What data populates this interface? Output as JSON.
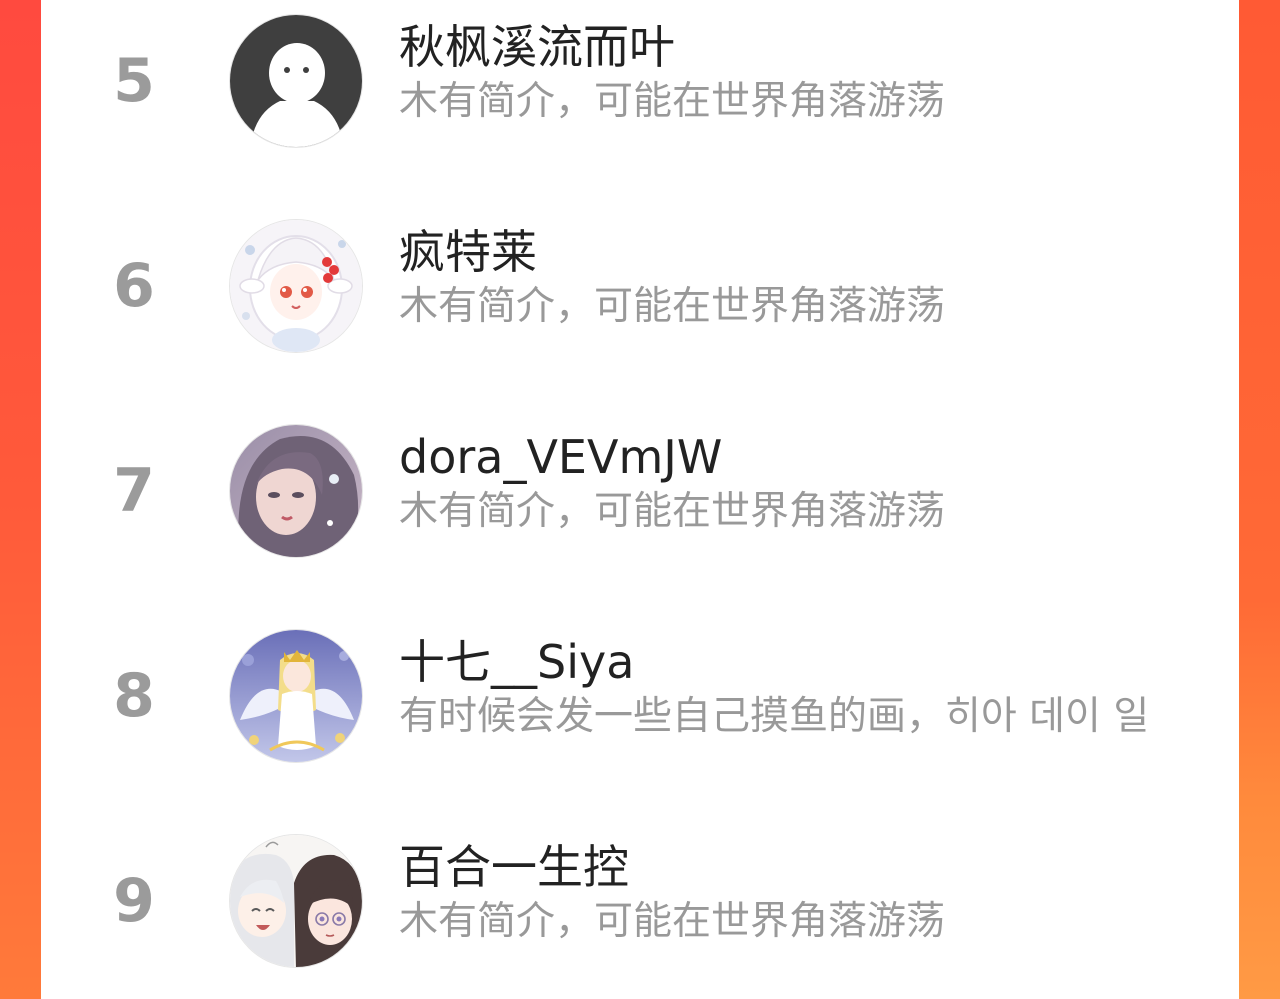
{
  "ranking": {
    "items": [
      {
        "rank": "5",
        "name": "秋枫溪流而叶",
        "bio": "木有简介，可能在世界角落游荡",
        "avatar_icon": "default-ghost-avatar"
      },
      {
        "rank": "6",
        "name": "疯特莱",
        "bio": "木有简介，可能在世界角落游荡",
        "avatar_icon": "anime-girl-white-hair-avatar"
      },
      {
        "rank": "7",
        "name": "dora_VEVmJW",
        "bio": "木有简介，可能在世界角落游荡",
        "avatar_icon": "illustrated-girl-avatar"
      },
      {
        "rank": "8",
        "name": "十七__Siya",
        "bio": "有时候会发一些自己摸鱼的画，히아 데이 일",
        "avatar_icon": "angel-wings-girl-avatar"
      },
      {
        "rank": "9",
        "name": "百合一生控",
        "bio": "木有简介，可能在世界角落游荡",
        "avatar_icon": "two-anime-girls-avatar"
      }
    ]
  },
  "colors": {
    "background_gradient_top": "#ff4a3f",
    "background_gradient_bottom": "#ff7a3a",
    "rank_text": "#9b9b9b",
    "name_text": "#222222",
    "bio_text": "#999999"
  }
}
